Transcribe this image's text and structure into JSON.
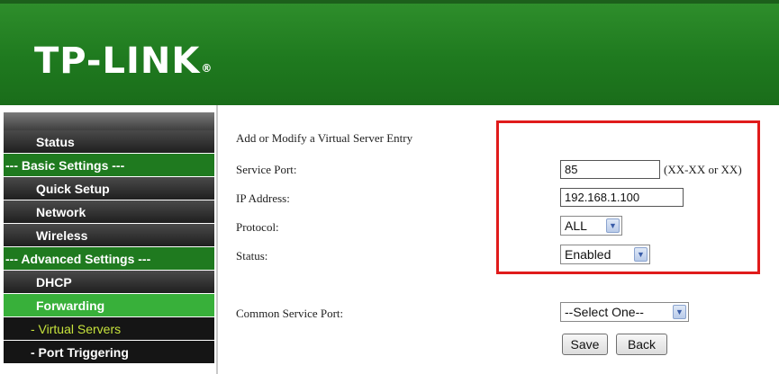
{
  "brand": {
    "logo": "TP-LINK",
    "trademark": "®"
  },
  "menu": {
    "items": [
      {
        "label": "Status"
      },
      {
        "label": "--- Basic Settings ---"
      },
      {
        "label": "Quick Setup"
      },
      {
        "label": "Network"
      },
      {
        "label": "Wireless"
      },
      {
        "label": "--- Advanced Settings ---"
      },
      {
        "label": "DHCP"
      },
      {
        "label": "Forwarding"
      },
      {
        "label": "- Virtual Servers"
      },
      {
        "label": "- Port Triggering"
      }
    ]
  },
  "form": {
    "title": "Add or Modify a Virtual Server Entry",
    "service_port": {
      "label": "Service Port:",
      "value": "85",
      "hint": "(XX-XX or XX)"
    },
    "ip_address": {
      "label": "IP Address:",
      "value": "192.168.1.100"
    },
    "protocol": {
      "label": "Protocol:",
      "value": "ALL"
    },
    "status": {
      "label": "Status:",
      "value": "Enabled"
    },
    "common_service_port": {
      "label": "Common Service Port:",
      "value": "--Select One--"
    },
    "save_label": "Save",
    "back_label": "Back"
  },
  "colors": {
    "brand_green": "#1f7a1f",
    "active_green": "#38b03a",
    "highlight_red": "#e01b1b"
  }
}
